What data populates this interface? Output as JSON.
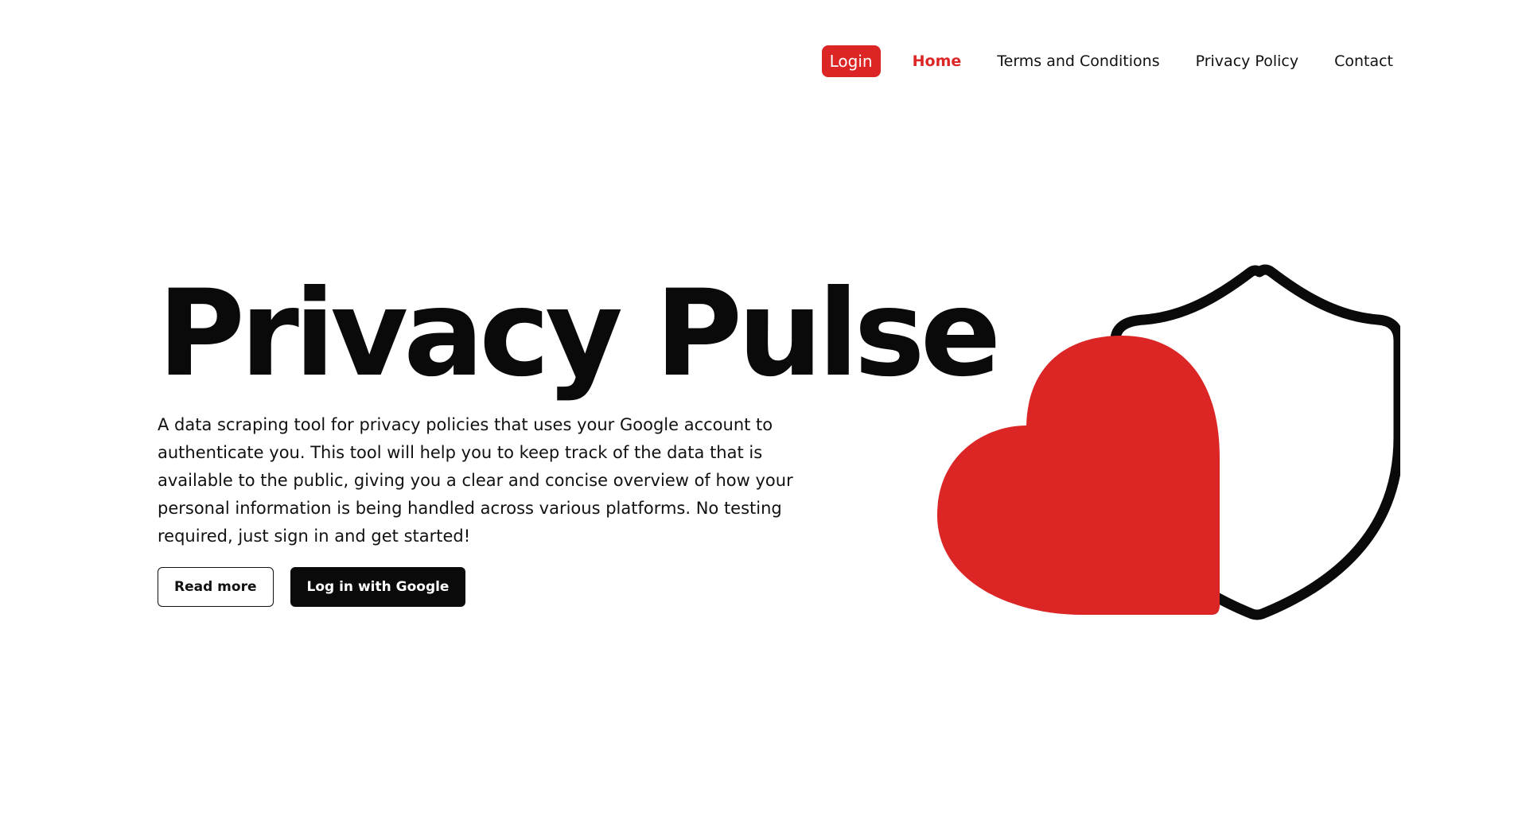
{
  "nav": {
    "login_label": "Login",
    "links": [
      {
        "label": "Home",
        "active": true
      },
      {
        "label": "Terms and Conditions",
        "active": false
      },
      {
        "label": "Privacy Policy",
        "active": false
      },
      {
        "label": "Contact",
        "active": false
      }
    ]
  },
  "hero": {
    "title": "Privacy Pulse",
    "description": "A data scraping tool for privacy policies that uses your Google account to authenticate you. This tool will help you to keep track of the data that is available to the public, giving you a clear and concise overview of how your personal information is being handled across various platforms. No testing required, just sign in and get started!",
    "read_more_label": "Read more",
    "google_login_label": "Log in with Google"
  },
  "illustration": {
    "icons": [
      "heart-icon",
      "shield-icon"
    ]
  },
  "colors": {
    "accent": "#dc2626",
    "dark": "#0a0a0a",
    "background": "#ffffff"
  }
}
